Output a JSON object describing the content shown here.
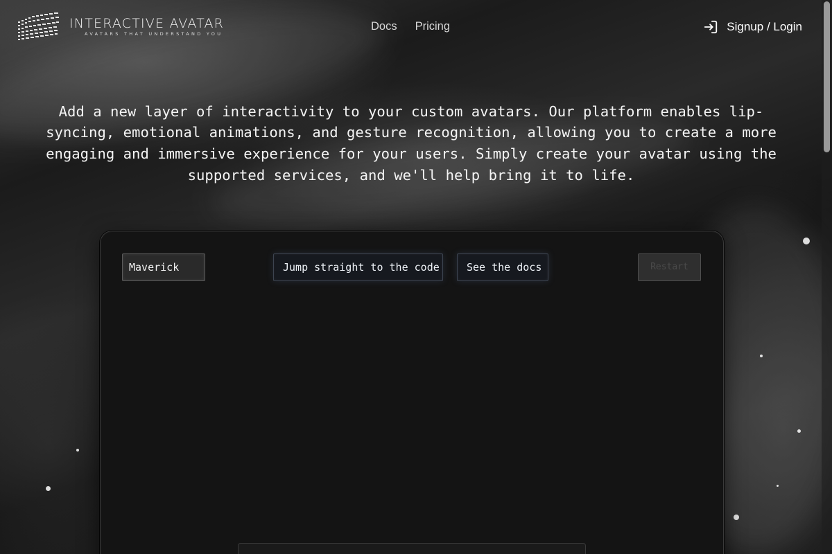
{
  "brand": {
    "title": "INTERACTIVE AVATAR",
    "tagline": "AVATARS THAT UNDERSTAND YOU",
    "logo_icon": "wave-mesh-logo-icon"
  },
  "nav": {
    "items": [
      {
        "label": "Docs"
      },
      {
        "label": "Pricing"
      }
    ]
  },
  "auth": {
    "label": "Signup / Login",
    "icon": "login-arrow-icon"
  },
  "hero": {
    "text": "Add a new layer of interactivity to your custom avatars. Our platform enables lip-syncing, emotional animations, and gesture recognition, allowing you to create a more engaging and immersive experience for your users. Simply create your avatar using the supported services, and we'll help bring it to life."
  },
  "panel": {
    "avatar_select": {
      "value": "Maverick"
    },
    "jump_button": {
      "label": "Jump straight to the code"
    },
    "docs_button": {
      "label": "See the docs"
    },
    "disabled_button": {
      "label": "Restart"
    }
  },
  "colors": {
    "background": "#0b0b0b",
    "panel": "#141414",
    "text": "#ffffff",
    "button_glow": "#5a78aa"
  }
}
